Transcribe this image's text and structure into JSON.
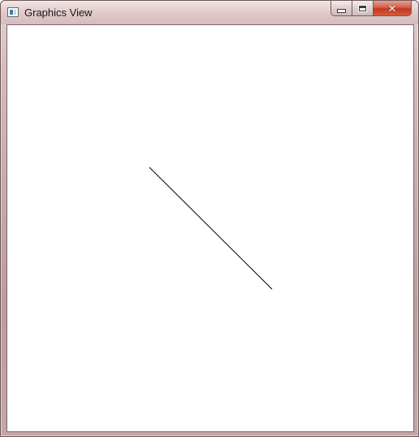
{
  "window": {
    "title": "Graphics View",
    "controls": {
      "minimize": "minimize",
      "maximize": "maximize",
      "close": "close"
    }
  },
  "icons": {
    "app": "app-window-icon",
    "minimize": "minimize-icon",
    "maximize": "maximize-icon",
    "close": "close-icon"
  },
  "colors": {
    "titlebar": "#d6bcbb",
    "close_button": "#c0391f",
    "canvas_background": "#ffffff",
    "line": "#000000"
  }
}
